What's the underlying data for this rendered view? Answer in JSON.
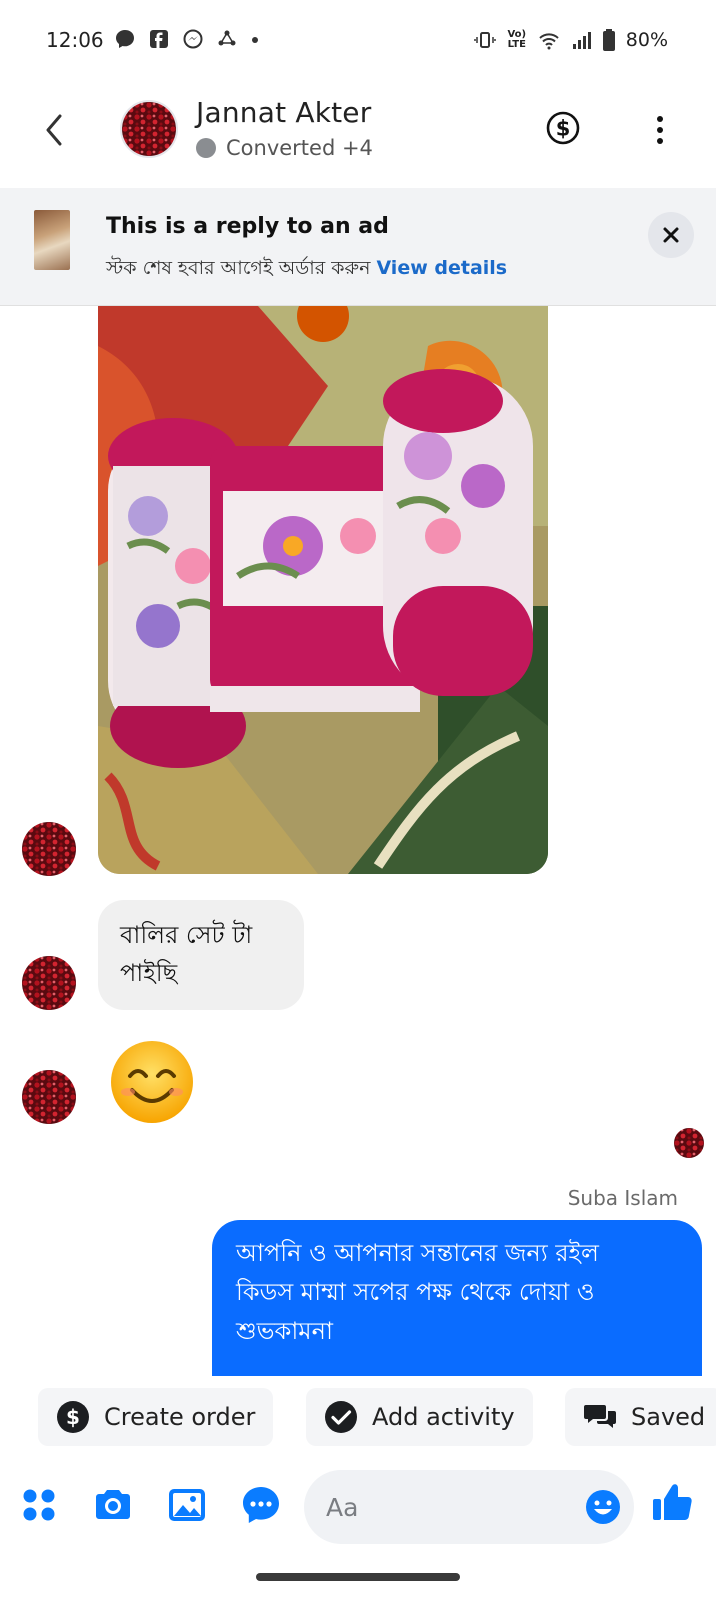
{
  "status_bar": {
    "time": "12:06",
    "battery": "80%",
    "network": "Vo) LTE"
  },
  "header": {
    "contact_name": "Jannat Akter",
    "contact_status": "Converted +4"
  },
  "ad_banner": {
    "title": "This is a reply to an ad",
    "subtitle": "স্টক শেষ হবার আগেই অর্ডার করুন",
    "link": "View details"
  },
  "messages": {
    "incoming_text_line1": "বালির সেট টা",
    "incoming_text_line2": "পাইছি",
    "emoji": "😊",
    "sender_name": "Suba Islam",
    "outgoing_line1": "আপনি ও আপনার সন্তানের জন্য রইল",
    "outgoing_line2": "কিডস মাম্মা সপের পক্ষ থেকে দোয়া ও",
    "outgoing_line3": "শুভকামনা"
  },
  "quick_actions": [
    {
      "label": "Create order",
      "icon": "dollar-circle-icon"
    },
    {
      "label": "Add activity",
      "icon": "check-circle-icon"
    },
    {
      "label": "Saved",
      "icon": "chat-bubbles-icon"
    }
  ],
  "composer": {
    "placeholder": "Aa"
  },
  "colors": {
    "messenger_blue": "#0a6cff",
    "link_blue": "#1b6ac9",
    "incoming_bubble": "#f0f0f0",
    "like_blue": "#0a7cff"
  }
}
